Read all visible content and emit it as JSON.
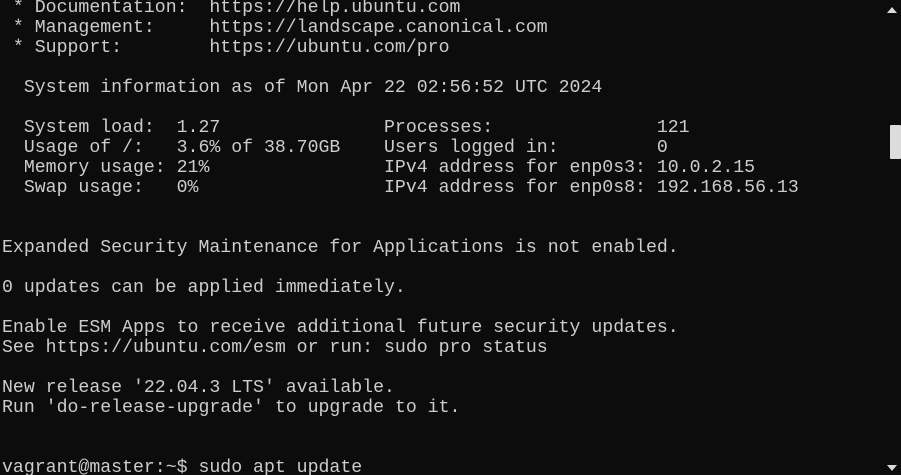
{
  "terminal": {
    "lines": [
      " * Documentation:  https://help.ubuntu.com",
      " * Management:     https://landscape.canonical.com",
      " * Support:        https://ubuntu.com/pro",
      "",
      "  System information as of Mon Apr 22 02:56:52 UTC 2024",
      "",
      "  System load:  1.27               Processes:               121",
      "  Usage of /:   3.6% of 38.70GB    Users logged in:         0",
      "  Memory usage: 21%                IPv4 address for enp0s3: 10.0.2.15",
      "  Swap usage:   0%                 IPv4 address for enp0s8: 192.168.56.13",
      "",
      "",
      "Expanded Security Maintenance for Applications is not enabled.",
      "",
      "0 updates can be applied immediately.",
      "",
      "Enable ESM Apps to receive additional future security updates.",
      "See https://ubuntu.com/esm or run: sudo pro status",
      "",
      "New release '22.04.3 LTS' available.",
      "Run 'do-release-upgrade' to upgrade to it.",
      "",
      "",
      "vagrant@master:~$ sudo apt update"
    ]
  },
  "scrollbar": {
    "up_icon": "chevron-up-icon",
    "down_icon": "chevron-down-icon"
  }
}
